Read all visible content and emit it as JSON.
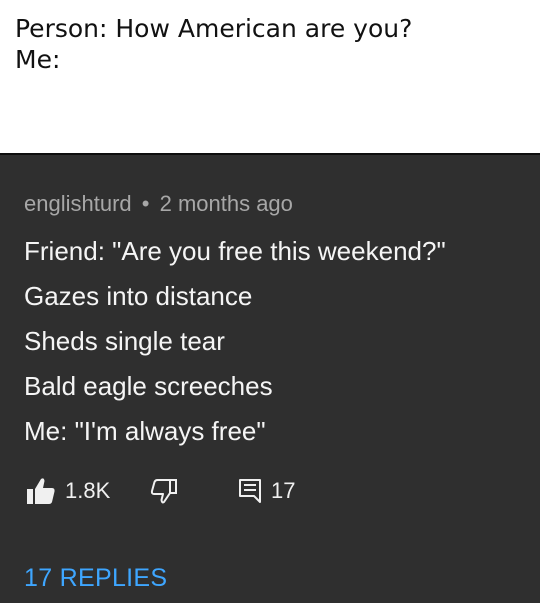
{
  "caption": {
    "line1": "Person: How American are you?",
    "line2": "Me:"
  },
  "comment": {
    "author": "englishturd",
    "separator": "•",
    "time": "2 months ago",
    "lines": [
      "Friend: \"Are you free this weekend?\"",
      "Gazes into distance",
      "Sheds single tear",
      "Bald eagle screeches",
      "Me: \"I'm always free\""
    ],
    "like_count": "1.8K",
    "reply_count": "17",
    "replies_label": "17 REPLIES"
  },
  "icons": {
    "like": "thumbs-up-icon",
    "dislike": "thumbs-down-icon",
    "reply": "comment-icon"
  },
  "colors": {
    "card_background": "#2f2f2f",
    "replies_link": "#3ea6ff",
    "meta_text": "#a7a7a7"
  }
}
